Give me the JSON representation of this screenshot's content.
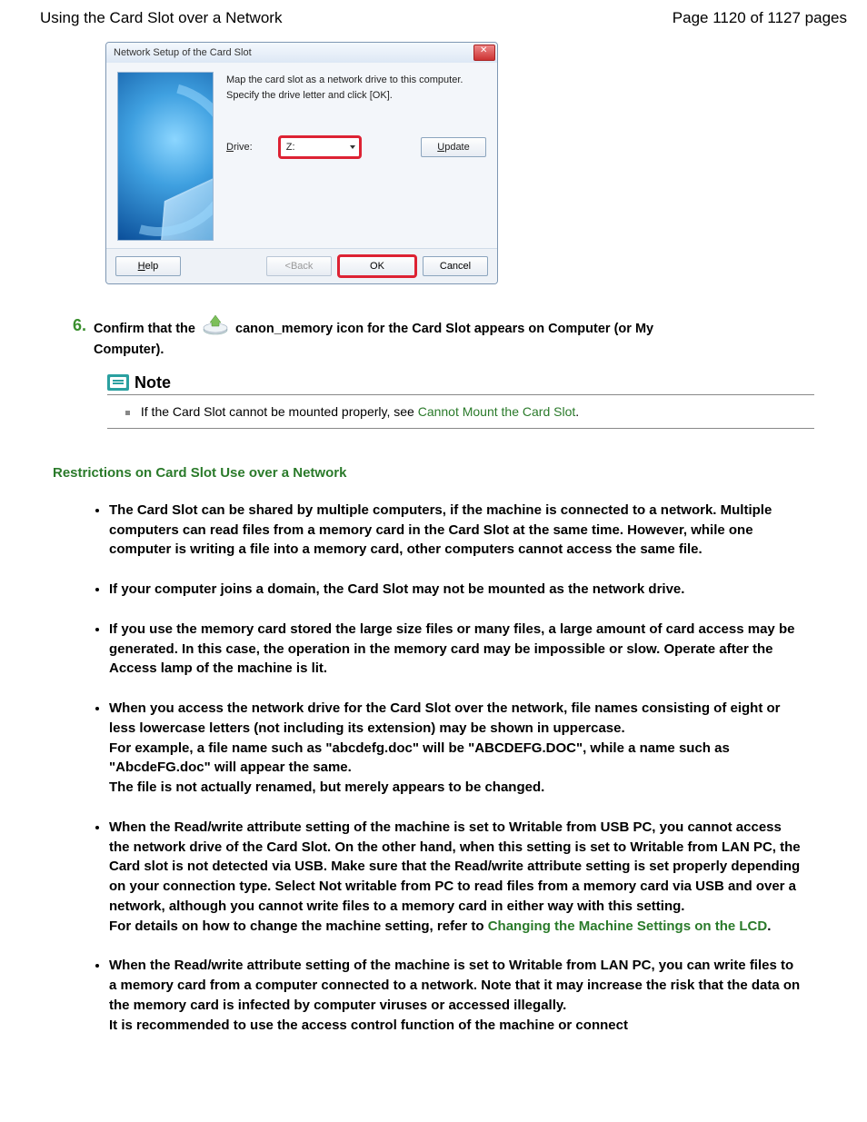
{
  "header": {
    "title": "Using the Card Slot over a Network",
    "page_label": "Page 1120 of 1127 pages"
  },
  "dialog": {
    "title": "Network Setup of the Card Slot",
    "line1": "Map the card slot as a network drive to this computer.",
    "line2": "Specify the drive letter and click [OK].",
    "drive_label": "Drive:",
    "drive_value": "Z:",
    "update_btn": "Update",
    "help_btn": "Help",
    "back_btn": "<Back",
    "ok_btn": "OK",
    "cancel_btn": "Cancel"
  },
  "step6": {
    "num": "6.",
    "pre": "Confirm that the",
    "post": "canon_memory icon for the Card Slot appears on Computer (or My Computer)."
  },
  "note": {
    "title": "Note",
    "body_pre": "If the Card Slot cannot be mounted properly, see ",
    "link": "Cannot Mount the Card Slot",
    "dot": "."
  },
  "restrictions": {
    "heading": "Restrictions on Card Slot Use over a Network",
    "items": [
      "The Card Slot can be shared by multiple computers, if the machine is connected to a network. Multiple computers can read files from a memory card in the Card Slot at the same time. However, while one computer is writing a file into a memory card, other computers cannot access the same file.",
      "If your computer joins a domain, the Card Slot may not be mounted as the network drive.",
      "If you use the memory card stored the large size files or many files, a large amount of card access may be generated. In this case, the operation in the memory card may be impossible or slow. Operate after the   Access lamp of the machine is lit.",
      "When you access the network drive for the Card Slot over the network, file names consisting of eight or less lowercase letters (not including its extension) may be shown in uppercase.\nFor example, a file name such as \"abcdefg.doc\" will be \"ABCDEFG.DOC\", while a name such as \"AbcdeFG.doc\" will appear the same.\nThe file is not actually renamed, but merely appears to be changed."
    ],
    "item5": {
      "a": "When the Read/write attribute setting of the machine is set to Writable from USB PC, you cannot access the network drive of the Card Slot. On the other hand, when this setting is set to Writable from LAN PC, the Card slot is not detected via USB. Make sure that the Read/write attribute setting is set properly depending on your connection type. Select Not writable from PC to read files from a memory card via USB and over a network, although you cannot write files to a memory card in either way with this setting.\nFor details on how to change the machine setting, refer to  ",
      "link": "Changing the Machine Settings on the LCD",
      "b": "."
    },
    "item6": "When the Read/write attribute setting of the machine is set to Writable from LAN PC, you can write files to a memory card from a computer connected to a network. Note that it may increase the risk that the data on the memory card is infected by computer viruses or accessed illegally.\nIt is recommended to use the access control function of the machine or connect"
  }
}
